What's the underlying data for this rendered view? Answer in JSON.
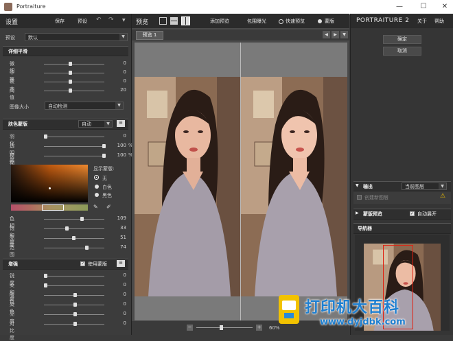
{
  "window": {
    "title": "Portraiture",
    "minimize_glyph": "—",
    "maximize_glyph": "☐",
    "close_glyph": "✕"
  },
  "left": {
    "header": {
      "title": "设置",
      "save": "保存",
      "preset_btn": "预设"
    },
    "preset": {
      "label": "预设",
      "value": "默认"
    },
    "detail": {
      "title": "详细平滑",
      "sliders": [
        {
          "label": "微细",
          "value": "0",
          "fraction": 0.42
        },
        {
          "label": "中等",
          "value": "0",
          "fraction": 0.42
        },
        {
          "label": "较大",
          "value": "0",
          "fraction": 0.42
        },
        {
          "label": "阈值",
          "value": "20",
          "fraction": 0.42
        }
      ],
      "image_size_label": "图像大小",
      "image_size_value": "自动检测"
    },
    "skin_mask": {
      "title": "肤色蒙版",
      "mode": "自动",
      "sliders": [
        {
          "label": "羽化",
          "value": "0",
          "fraction": 0.0
        },
        {
          "label": "透明度",
          "value": "100",
          "unit": "%",
          "fraction": 1.0
        },
        {
          "label": "模糊",
          "value": "100",
          "unit": "%",
          "fraction": 1.0
        }
      ],
      "show_mask_label": "显示蒙版:",
      "show_options": [
        "无",
        "白色",
        "黑色"
      ],
      "hsl": [
        {
          "label": "色相",
          "value": "109",
          "fraction": 0.62
        },
        {
          "label": "饱和度",
          "value": "33",
          "fraction": 0.36
        },
        {
          "label": "亮度",
          "value": "51",
          "fraction": 0.48
        },
        {
          "label": "范围",
          "value": "74",
          "fraction": 0.7
        }
      ]
    },
    "enhance": {
      "title": "增强",
      "use_mask_label": "使用蒙版",
      "sliders": [
        {
          "label": "锐度",
          "value": "0",
          "fraction": 0.0
        },
        {
          "label": "柔和度",
          "value": "0",
          "fraction": 0.0
        },
        {
          "label": "暖色",
          "value": "0",
          "fraction": 0.5
        },
        {
          "label": "染色",
          "value": "0",
          "fraction": 0.5
        },
        {
          "label": "亮度",
          "value": "0",
          "fraction": 0.5
        },
        {
          "label": "对比度",
          "value": "0",
          "fraction": 0.5
        }
      ]
    }
  },
  "center": {
    "title": "预览",
    "add_preview": "添加预览",
    "compare_exposure": "包围曝光",
    "quick_preview": "快速预览",
    "mask": "蒙版",
    "tab": "预览 1",
    "zoom": "60%"
  },
  "right": {
    "brand": "PORTRAITURE 2",
    "about": "关于",
    "help": "帮助",
    "ok": "确定",
    "cancel": "取消",
    "output": {
      "title": "输出",
      "dest": "当前图层",
      "new_layer": "创建新图层"
    },
    "mask_preview": {
      "title": "蒙版预览",
      "auto_expand": "自动展开"
    },
    "navigator": {
      "title": "导航器"
    }
  },
  "watermark": {
    "text": "打印机大百科",
    "url": "www.dyjdbk.com"
  },
  "colors": {
    "panel": "#3c3c3c",
    "header": "#2b2b2b",
    "accent": "#e06020",
    "warning": "#f2c200"
  }
}
